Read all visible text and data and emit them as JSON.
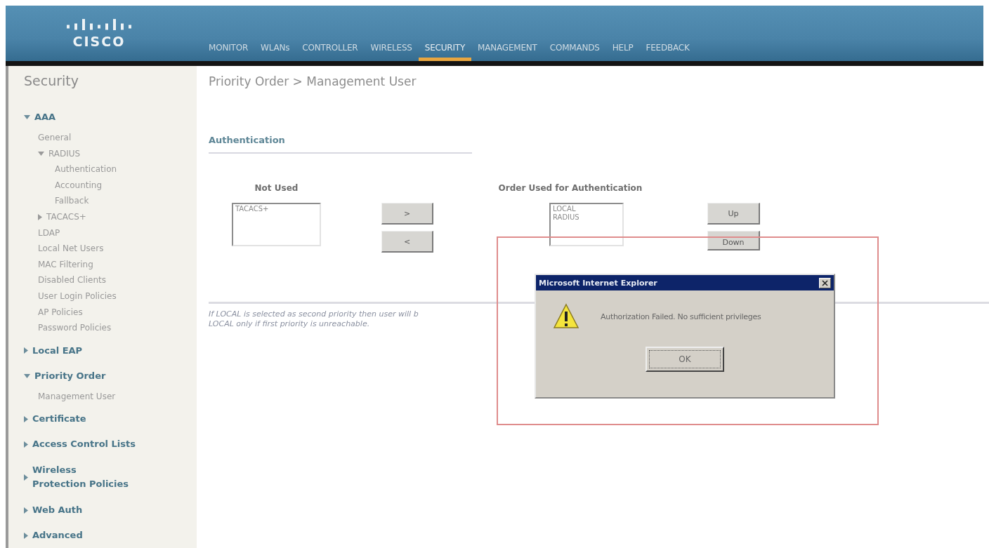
{
  "header": {
    "logo": "CISCO",
    "nav": [
      {
        "label": "MONITOR",
        "selected": false
      },
      {
        "label": "WLANs",
        "selected": false
      },
      {
        "label": "CONTROLLER",
        "selected": false
      },
      {
        "label": "WIRELESS",
        "selected": false
      },
      {
        "label": "SECURITY",
        "selected": true
      },
      {
        "label": "MANAGEMENT",
        "selected": false
      },
      {
        "label": "COMMANDS",
        "selected": false
      },
      {
        "label": "HELP",
        "selected": false
      },
      {
        "label": "FEEDBACK",
        "selected": false
      }
    ]
  },
  "sidebar": {
    "title": "Security",
    "items": [
      {
        "label": "AAA",
        "expanded": true,
        "children": [
          {
            "label": "General"
          },
          {
            "label": "RADIUS",
            "expanded": true,
            "children": [
              {
                "label": "Authentication"
              },
              {
                "label": "Accounting"
              },
              {
                "label": "Fallback"
              }
            ]
          },
          {
            "label": "TACACS+",
            "expanded": false
          },
          {
            "label": "LDAP"
          },
          {
            "label": "Local Net Users"
          },
          {
            "label": "MAC Filtering"
          },
          {
            "label": "Disabled Clients"
          },
          {
            "label": "User Login Policies"
          },
          {
            "label": "AP Policies"
          },
          {
            "label": "Password Policies"
          }
        ]
      },
      {
        "label": "Local EAP",
        "expanded": false
      },
      {
        "label": "Priority Order",
        "expanded": true,
        "children": [
          {
            "label": "Management User"
          }
        ]
      },
      {
        "label": "Certificate",
        "expanded": false
      },
      {
        "label": "Access Control Lists",
        "expanded": false
      },
      {
        "label": "Wireless Protection Policies",
        "expanded": false
      },
      {
        "label": "Web Auth",
        "expanded": false
      },
      {
        "label": "Advanced",
        "expanded": false
      }
    ]
  },
  "page": {
    "breadcrumb": "Priority Order > Management User",
    "section": "Authentication",
    "not_used": {
      "heading": "Not Used",
      "options": [
        "TACACS+"
      ]
    },
    "move_buttons": [
      ">",
      "<"
    ],
    "order_used": {
      "heading": "Order Used for Authentication",
      "options": [
        "LOCAL",
        "RADIUS"
      ]
    },
    "order_buttons": [
      "Up",
      "Down"
    ],
    "note": [
      "If LOCAL is selected as second priority then user will b",
      "LOCAL only if first priority is unreachable."
    ]
  },
  "dialog": {
    "title": "Microsoft Internet Explorer",
    "message": "Authorization Failed. No sufficient privileges",
    "button": "OK"
  }
}
